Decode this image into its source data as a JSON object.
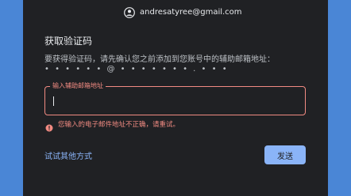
{
  "account": {
    "email": "andresatyree@gmail.com",
    "icon": "account-circle-icon"
  },
  "title": "获取验证码",
  "description": "要获得验证码，请先确认您之前添加到您账号中的辅助邮箱地址：",
  "masked_email": "• • • • • • @ • • • • • • • . • • •",
  "input": {
    "label": "输入辅助邮箱地址",
    "value": "",
    "placeholder": ""
  },
  "error": {
    "icon": "error-circle-icon",
    "text": "您输入的电子邮件地址不正确，请重试。"
  },
  "actions": {
    "try_other": "试试其他方式",
    "send": "发送"
  },
  "colors": {
    "background": "#4a86d6",
    "card": "#202124",
    "error": "#f28b82",
    "accent": "#8ab4f8"
  }
}
